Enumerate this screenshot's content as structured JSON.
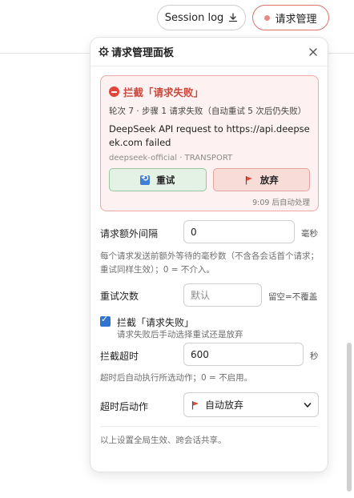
{
  "header": {
    "session_log_label": "Session log",
    "request_mgmt_label": "请求管理"
  },
  "panel": {
    "title": "请求管理面板",
    "alert": {
      "title": "拦截「请求失败」",
      "detail": "轮次 7 · 步骤 1 请求失败（自动重试 5 次后仍失败）",
      "message": "DeepSeek API request to https://api.deepseek.com failed",
      "source": "deepseek-official · TRANSPORT",
      "retry_label": "重试",
      "give_up_label": "放弃",
      "footer": "9:09 后自动处理"
    },
    "extra_interval": {
      "label": "请求额外间隔",
      "value": "0",
      "unit": "毫秒",
      "help": "每个请求发送前额外等待的毫秒数（不含各会话首个请求；重试同样生效）；0 = 不介入。"
    },
    "retry_count": {
      "label": "重试次数",
      "placeholder": "默认",
      "hint": "留空=不覆盖"
    },
    "intercept": {
      "checked": true,
      "label": "拦截「请求失败」",
      "help": "请求失败后手动选择重试还是放弃"
    },
    "intercept_timeout": {
      "label": "拦截超时",
      "value": "600",
      "unit": "秒",
      "help": "超时后自动执行所选动作；0 = 不启用。"
    },
    "timeout_action": {
      "label": "超时后动作",
      "selected": "自动放弃"
    },
    "footer_note": "以上设置全局生效、跨会话共享。"
  },
  "colors": {
    "accent_red": "#e0473a",
    "retry_bg": "#e4f1e5",
    "give_up_bg": "#f7dcd8",
    "checkbox": "#2f74d0"
  },
  "icons": {
    "download": "download-icon",
    "status_dot": "status-dot-icon",
    "gear": "gear-icon",
    "close": "close-icon",
    "stop": "stop-icon",
    "retry": "retry-icon",
    "flag": "flag-icon",
    "chevron": "chevron-down-icon"
  }
}
